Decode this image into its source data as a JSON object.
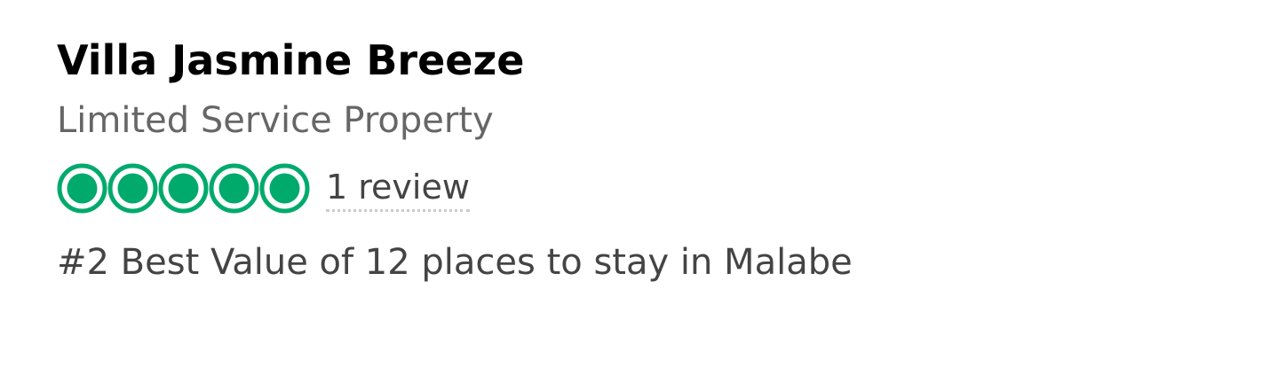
{
  "listing": {
    "name": "Villa Jasmine Breeze",
    "category": "Limited Service Property",
    "rating": {
      "value": 5,
      "max": 5,
      "bubble_color": "#00aa6c",
      "icon": "rating-bubble-icon"
    },
    "reviews_label": "1 review",
    "ranking": "#2 Best Value of 12 places to stay in Malabe"
  }
}
